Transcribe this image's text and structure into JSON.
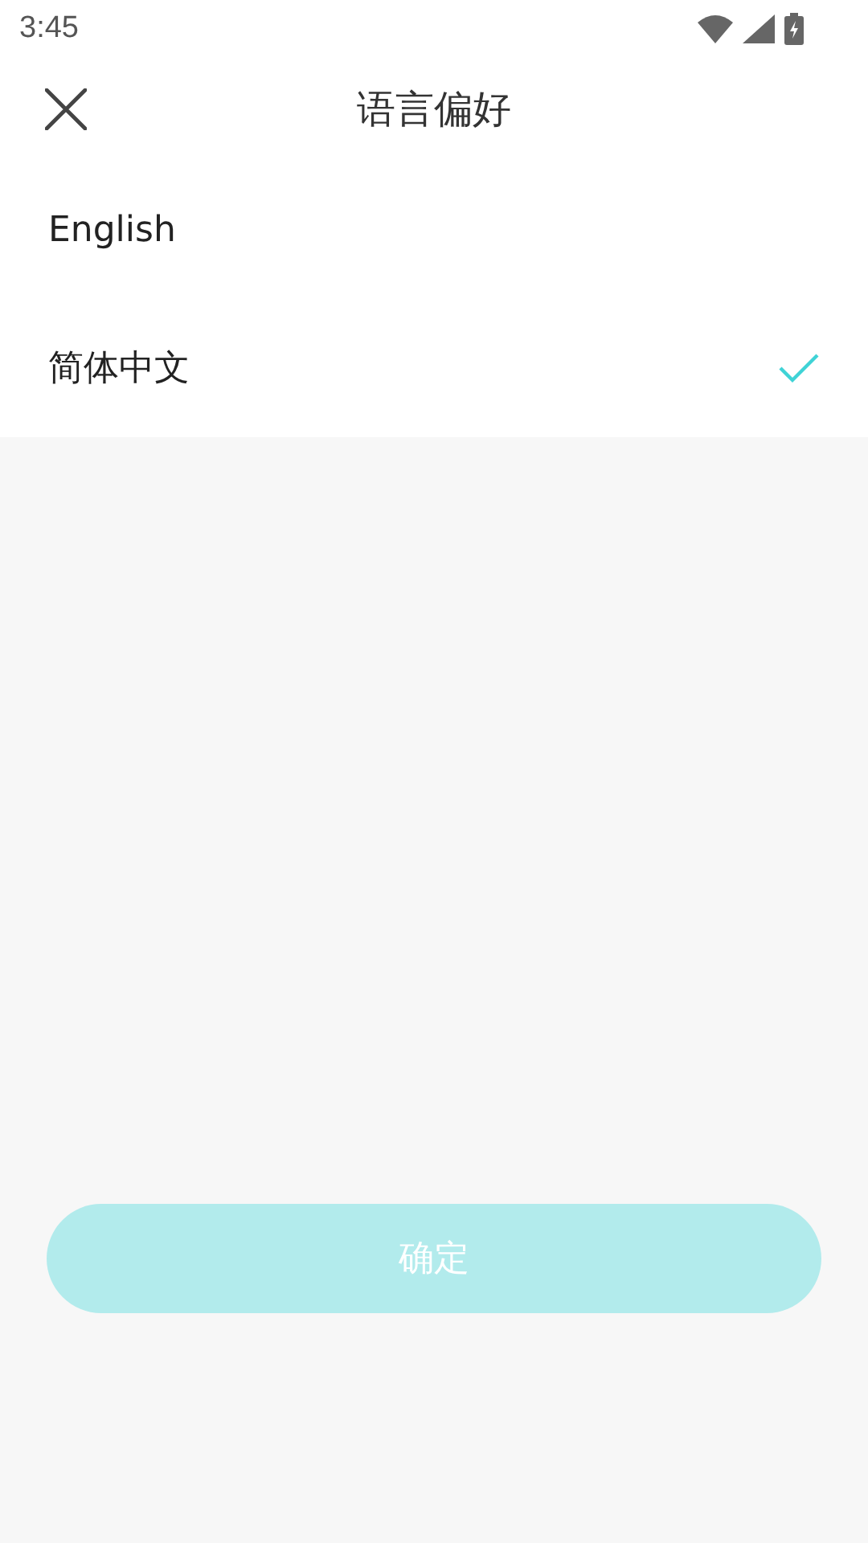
{
  "status_bar": {
    "time": "3:45"
  },
  "header": {
    "title": "语言偏好"
  },
  "languages": [
    {
      "label": "English",
      "selected": false
    },
    {
      "label": "简体中文",
      "selected": true
    }
  ],
  "confirm_button": {
    "label": "确定",
    "disabled": true
  }
}
